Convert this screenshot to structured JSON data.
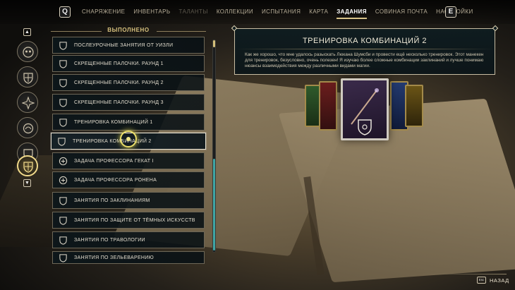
{
  "nav": {
    "left_key": "Q",
    "right_key": "E",
    "tabs": [
      {
        "label": "СНАРЯЖЕНИЕ",
        "state": "normal"
      },
      {
        "label": "ИНВЕНТАРЬ",
        "state": "normal"
      },
      {
        "label": "ТАЛАНТЫ",
        "state": "disabled"
      },
      {
        "label": "КОЛЛЕКЦИИ",
        "state": "normal"
      },
      {
        "label": "ИСПЫТАНИЯ",
        "state": "normal"
      },
      {
        "label": "КАРТА",
        "state": "normal"
      },
      {
        "label": "ЗАДАНИЯ",
        "state": "active"
      },
      {
        "label": "СОВИНАЯ ПОЧТА",
        "state": "normal"
      },
      {
        "label": "НАСТРОЙКИ",
        "state": "normal"
      }
    ]
  },
  "rail": {
    "categories": [
      {
        "icon": "owl-emblem-icon"
      },
      {
        "icon": "hogwarts-crest-icon"
      },
      {
        "icon": "compass-star-icon"
      },
      {
        "icon": "beast-emblem-icon"
      },
      {
        "icon": "shield-emblem-icon"
      },
      {
        "icon": "hogwarts-crest-active-icon",
        "active": true
      }
    ]
  },
  "list": {
    "header": "ВЫПОЛНЕНО",
    "quests": [
      {
        "label": "ПОСЛЕУРОЧНЫЕ ЗАНЯТИЯ ОТ УИЗЛИ",
        "icon": "crest-quest-icon"
      },
      {
        "label": "СКРЕЩЕННЫЕ ПАЛОЧКИ. РАУНД 1",
        "icon": "crest-quest-icon"
      },
      {
        "label": "СКРЕЩЕННЫЕ ПАЛОЧКИ. РАУНД 2",
        "icon": "crest-quest-icon"
      },
      {
        "label": "СКРЕЩЕННЫЕ ПАЛОЧКИ. РАУНД 3",
        "icon": "crest-quest-icon"
      },
      {
        "label": "ТРЕНИРОВКА КОМБИНАЦИЙ 1",
        "icon": "crest-quest-icon"
      },
      {
        "label": "ТРЕНИРОВКА КОМБИНАЦИЙ 2",
        "icon": "crest-quest-icon",
        "selected": true
      },
      {
        "label": "ЗАДАЧА ПРОФЕССОРА ГЕКАТ I",
        "icon": "assignment-quest-icon"
      },
      {
        "label": "ЗАДАЧА ПРОФЕССОРА РОНЕНА",
        "icon": "assignment-quest-icon"
      },
      {
        "label": "ЗАНЯТИЯ ПО ЗАКЛИНАНИЯМ",
        "icon": "crest-quest-icon"
      },
      {
        "label": "ЗАНЯТИЯ ПО ЗАЩИТЕ ОТ ТЁМНЫХ ИСКУССТВ",
        "icon": "crest-quest-icon"
      },
      {
        "label": "ЗАНЯТИЯ ПО ТРАВОЛОГИИ",
        "icon": "crest-quest-icon"
      },
      {
        "label": "ЗАНЯТИЯ ПО ЗЕЛЬЕВАРЕНИЮ",
        "icon": "crest-quest-icon"
      }
    ]
  },
  "detail": {
    "title": "ТРЕНИРОВКА КОМБИНАЦИЙ 2",
    "description": "Как же хорошо, что мне удалось разыскать Люкана Шумсби и провести ещё несколько тренировок. Этот манекен для тренировок, безусловно, очень полезен! Я изучаю более сложные комбинации заклинаний и лучше понимаю нюансы взаимодействия между различными видами магии."
  },
  "footer": {
    "back_key": "Esc",
    "back_label": "НАЗАД"
  },
  "colors": {
    "accent_gold": "#d8c48a",
    "scroll_teal": "#3fa5a4",
    "panel_bg": "#0e1a1e"
  }
}
